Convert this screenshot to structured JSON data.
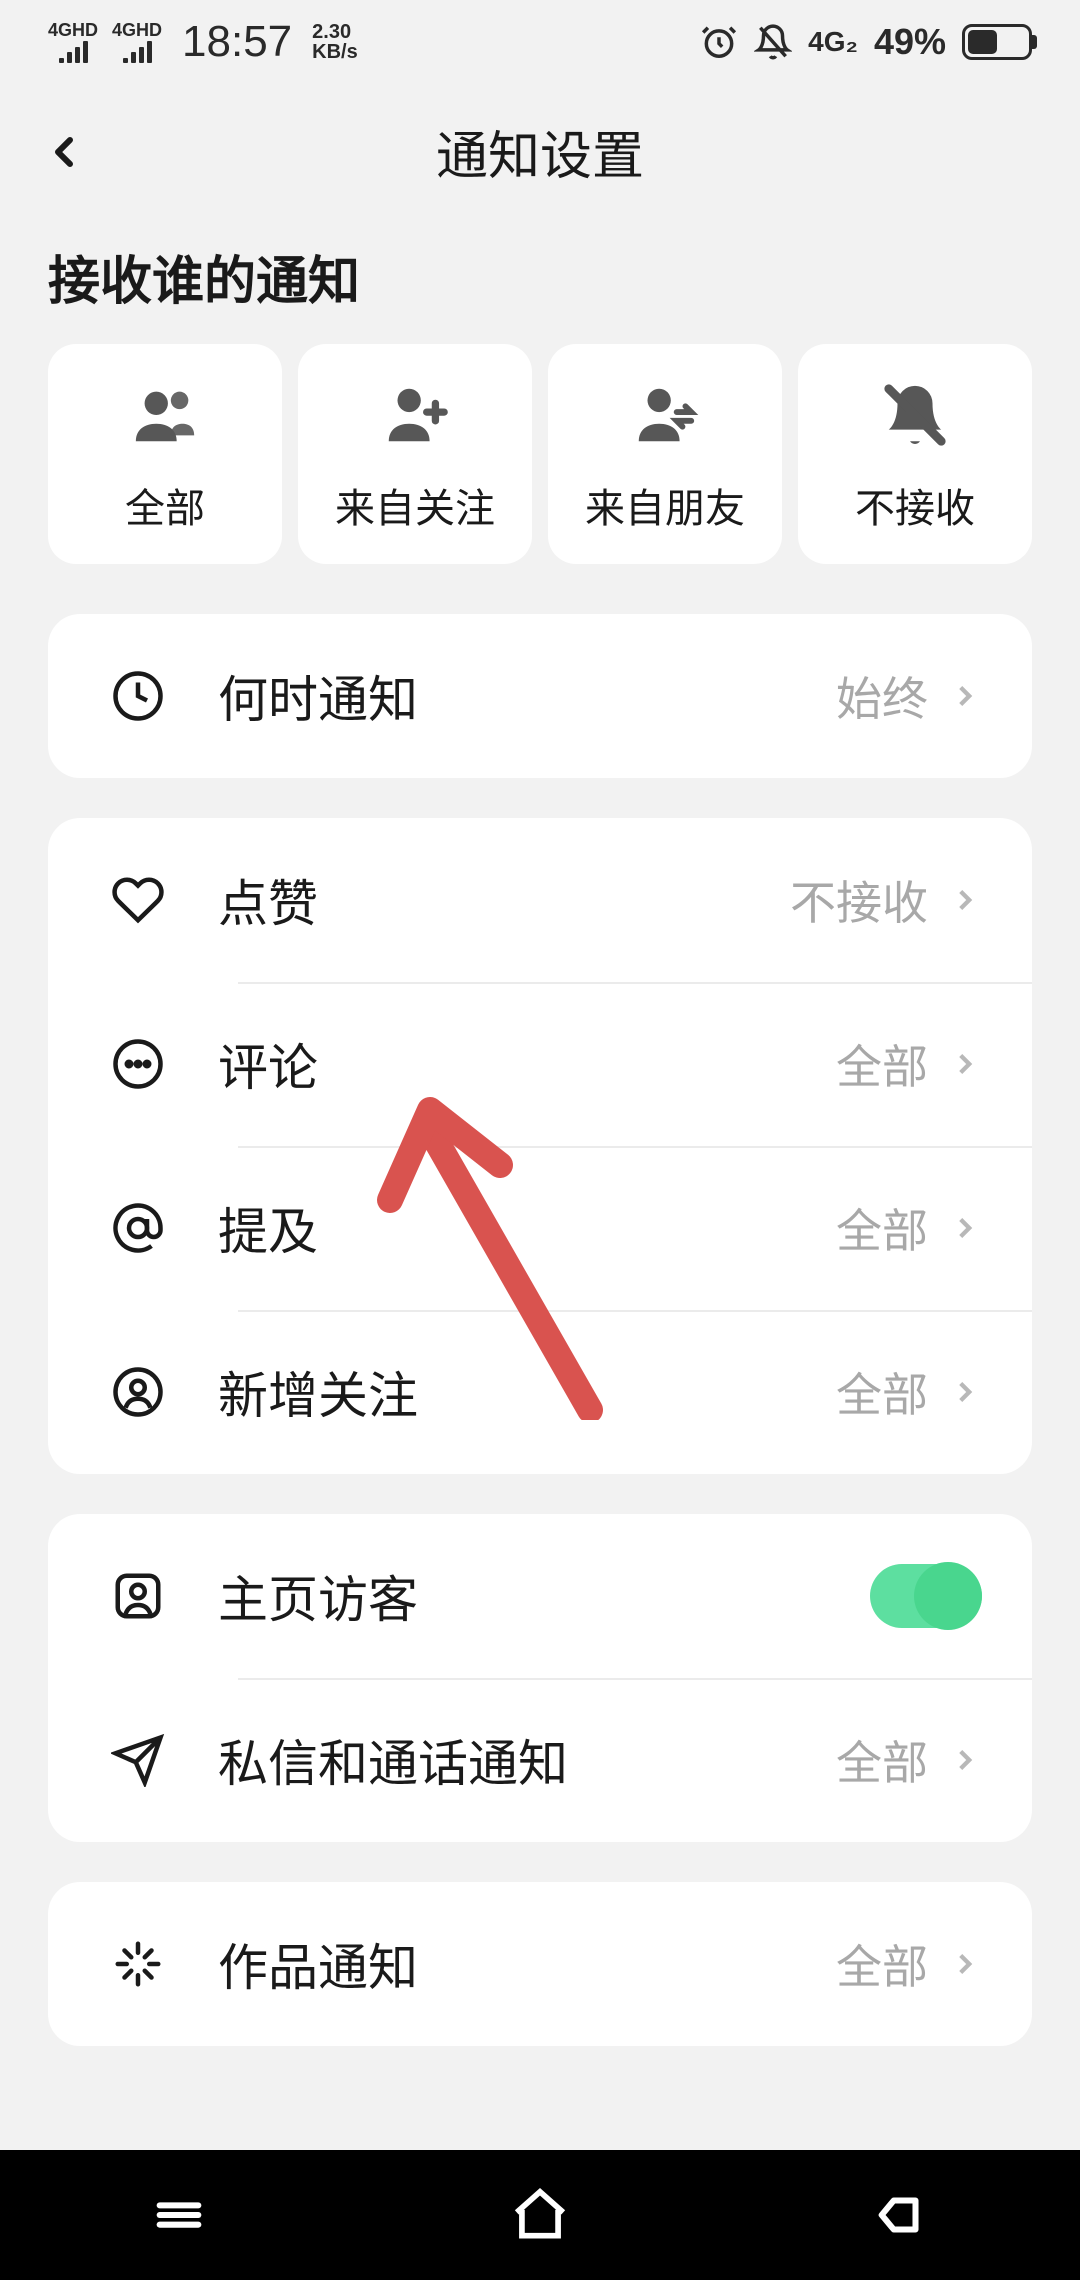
{
  "statusBar": {
    "signal1": "4GHD",
    "signal2": "4GHD",
    "time": "18:57",
    "speed_value": "2.30",
    "speed_unit": "KB/s",
    "network": "4G₂",
    "battery": "49%"
  },
  "header": {
    "title": "通知设置"
  },
  "sectionTitle": "接收谁的通知",
  "filters": [
    {
      "label": "全部"
    },
    {
      "label": "来自关注"
    },
    {
      "label": "来自朋友"
    },
    {
      "label": "不接收"
    }
  ],
  "rows": {
    "when": {
      "label": "何时通知",
      "value": "始终"
    },
    "like": {
      "label": "点赞",
      "value": "不接收"
    },
    "comment": {
      "label": "评论",
      "value": "全部"
    },
    "mention": {
      "label": "提及",
      "value": "全部"
    },
    "newFollow": {
      "label": "新增关注",
      "value": "全部"
    },
    "visitor": {
      "label": "主页访客"
    },
    "dm": {
      "label": "私信和通话通知",
      "value": "全部"
    },
    "works": {
      "label": "作品通知",
      "value": "全部"
    }
  }
}
